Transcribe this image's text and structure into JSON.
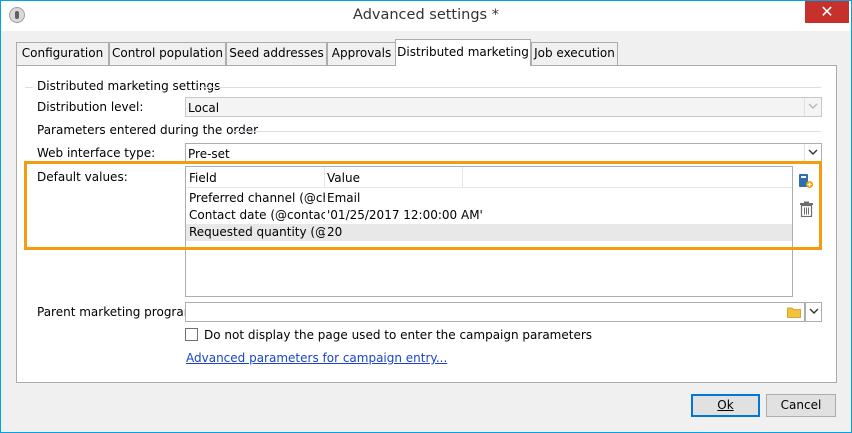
{
  "window": {
    "title": "Advanced settings *",
    "close_glyph": "✕"
  },
  "tabs": [
    {
      "label": "Configuration",
      "active": false
    },
    {
      "label": "Control population",
      "active": false
    },
    {
      "label": "Seed addresses",
      "active": false
    },
    {
      "label": "Approvals",
      "active": false
    },
    {
      "label": "Distributed marketing",
      "active": true
    },
    {
      "label": "Job execution",
      "active": false
    }
  ],
  "distributed": {
    "group_title": "Distributed marketing settings",
    "distribution_level_label": "Distribution level:",
    "distribution_level_value": "Local",
    "params_group_title": "Parameters entered during the order",
    "web_interface_label": "Web interface type:",
    "web_interface_value": "Pre-set",
    "default_values_label": "Default values:",
    "grid": {
      "columns": [
        "Field",
        "Value"
      ],
      "rows": [
        {
          "field": "Preferred channel (@cha...",
          "value": "Email",
          "selected": false
        },
        {
          "field": "Contact date (@contact...",
          "value": "'01/25/2017 12:00:00 AM'",
          "selected": false
        },
        {
          "field": "Requested quantity (@...",
          "value": "20",
          "selected": true
        }
      ]
    },
    "parent_program_label": "Parent marketing program:",
    "parent_program_value": "",
    "checkbox_label": "Do not display the page used to enter the campaign parameters",
    "checkbox_checked": false,
    "advanced_link": "Advanced parameters for campaign entry..."
  },
  "buttons": {
    "ok": "Ok",
    "cancel": "Cancel"
  },
  "icons": {
    "add_icon": "edit-add-icon",
    "delete_icon": "trash-icon",
    "folder_icon": "folder-icon",
    "dropdown_icon": "chevron-down-icon"
  },
  "colors": {
    "highlight": "#f39c12",
    "link": "#1a44c9",
    "close": "#c7312b"
  }
}
